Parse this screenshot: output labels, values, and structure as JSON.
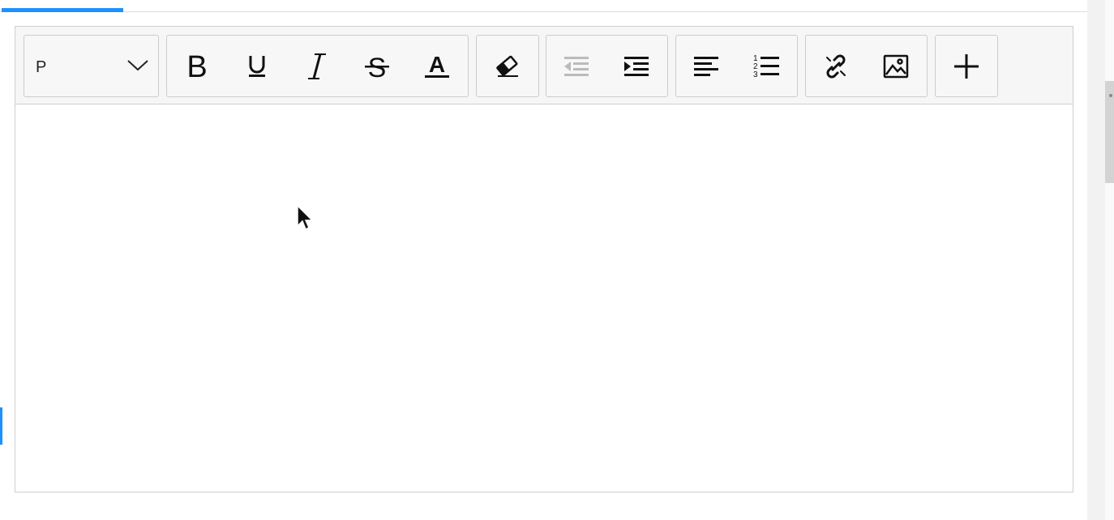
{
  "editor": {
    "format_select": {
      "selected": "P"
    },
    "toolbar": {
      "groups": [
        {
          "name": "text-style",
          "buttons": [
            "bold",
            "underline",
            "italic",
            "strikethrough",
            "font-color"
          ]
        },
        {
          "name": "clear",
          "buttons": [
            "remove-format"
          ]
        },
        {
          "name": "indent",
          "buttons": [
            "outdent",
            "indent"
          ]
        },
        {
          "name": "lists",
          "buttons": [
            "align-left",
            "ordered-list"
          ]
        },
        {
          "name": "insert",
          "buttons": [
            "unlink",
            "image"
          ]
        },
        {
          "name": "more",
          "buttons": [
            "add"
          ]
        }
      ],
      "icons": {
        "bold": "bold-icon",
        "underline": "underline-icon",
        "italic": "italic-icon",
        "strikethrough": "strikethrough-icon",
        "font_color": "font-color-icon",
        "remove_format": "eraser-icon",
        "outdent": "outdent-icon",
        "indent": "indent-icon",
        "align_left": "align-left-icon",
        "ordered_list": "ordered-list-icon",
        "unlink": "unlink-icon",
        "image": "image-icon",
        "add": "plus-icon"
      },
      "disabled": [
        "outdent"
      ]
    },
    "content": {
      "text": ""
    }
  },
  "colors": {
    "accent": "#1e90ff",
    "icon": "#111111",
    "icon_disabled": "#bbbbbb",
    "border": "#cfcfcf",
    "toolbar_bg": "#f6f6f6"
  }
}
